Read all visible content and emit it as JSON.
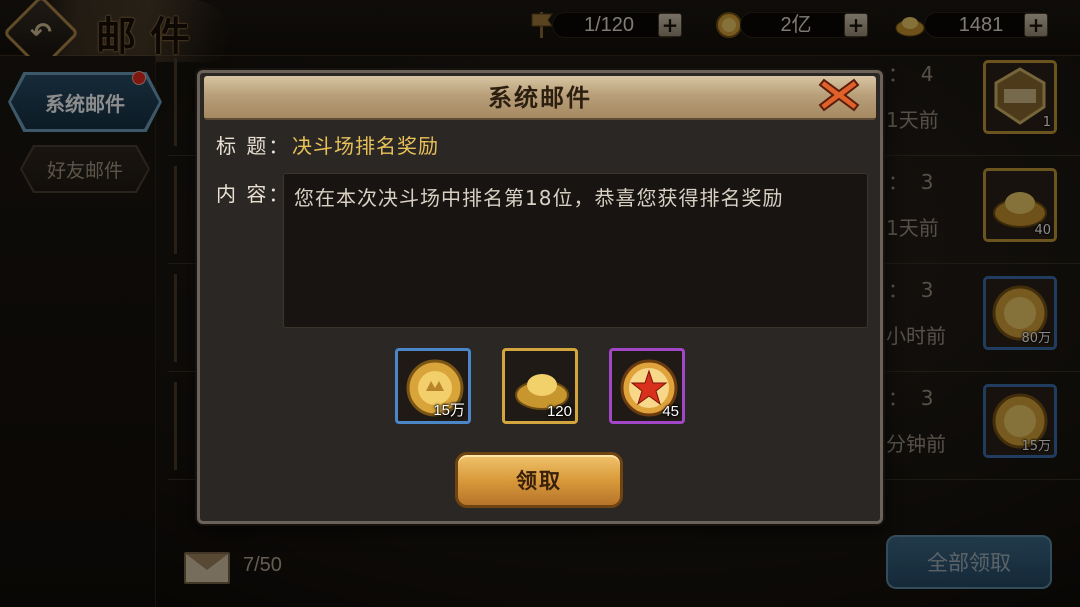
{
  "header": {
    "title": "邮件",
    "resources": [
      {
        "icon": "stamina-flag-icon",
        "value": "1/120"
      },
      {
        "icon": "coin-icon",
        "value": "2亿"
      },
      {
        "icon": "gold-ingot-icon",
        "value": "1481"
      }
    ]
  },
  "sidebar": {
    "tabs": [
      {
        "label": "系统邮件",
        "active": true,
        "has_notification": true
      },
      {
        "label": "好友邮件",
        "active": false
      }
    ]
  },
  "mail_list": {
    "rows": [
      {
        "count_label": "4",
        "time": "1天前",
        "thumb": "title-badge-icon",
        "thumb_count": "1"
      },
      {
        "count_label": "3",
        "time": "1天前",
        "thumb": "gold-ingot-icon",
        "thumb_count": "40"
      },
      {
        "count_label": "3",
        "time": "小时前",
        "thumb": "coin-icon",
        "thumb_count": "80万"
      },
      {
        "count_label": "3",
        "time": "分钟前",
        "thumb": "coin-icon",
        "thumb_count": "15万"
      }
    ]
  },
  "footer": {
    "mail_count": "7/50",
    "collect_all_label": "全部领取"
  },
  "dialog": {
    "title": "系统邮件",
    "subject_label": "标 题：",
    "subject": "决斗场排名奖励",
    "content_label": "内 容：",
    "content": "您在本次决斗场中排名第18位，恭喜您获得排名奖励",
    "rewards": [
      {
        "icon": "coin-icon",
        "count": "15万",
        "rarity": "blue"
      },
      {
        "icon": "gold-ingot-icon",
        "count": "120",
        "rarity": "gold"
      },
      {
        "icon": "star-medal-icon",
        "count": "45",
        "rarity": "purple"
      }
    ],
    "claim_label": "领取"
  },
  "colors": {
    "subject_text": "#e8c15a",
    "active_tab": "#284d66",
    "claim_button": "#d99a3b"
  }
}
